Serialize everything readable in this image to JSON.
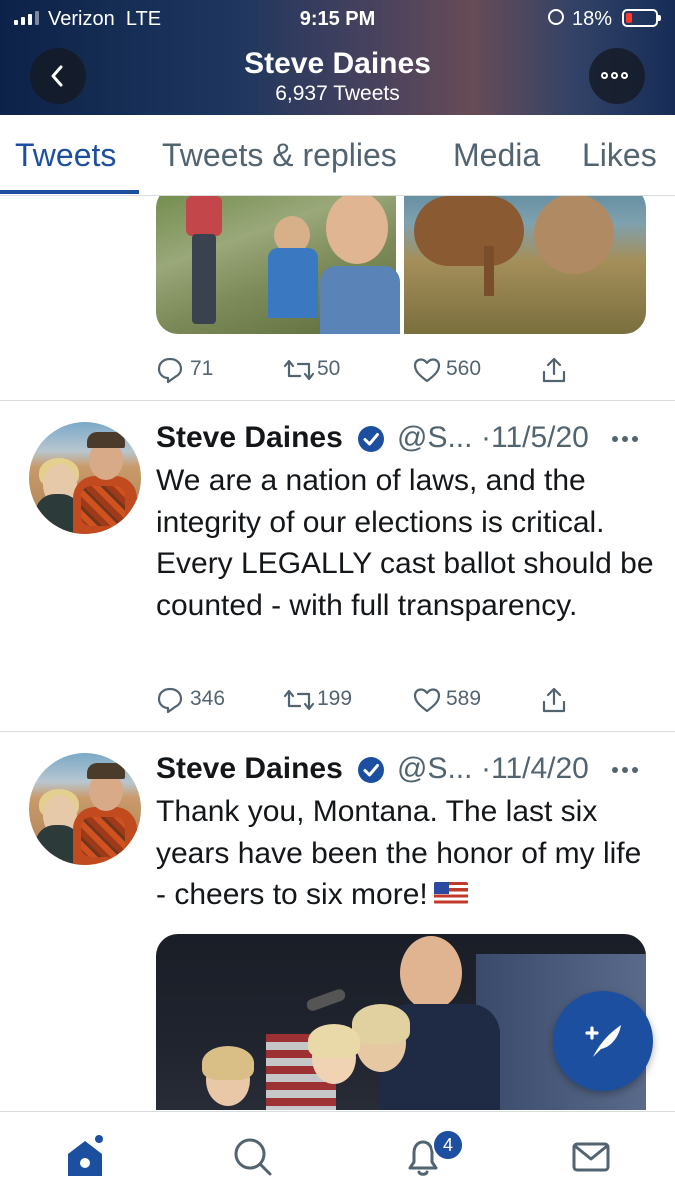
{
  "status_bar": {
    "carrier": "Verizon",
    "network": "LTE",
    "time": "9:15 PM",
    "battery": "18%"
  },
  "header": {
    "title": "Steve Daines",
    "subtitle": "6,937 Tweets"
  },
  "tabs": [
    "Tweets",
    "Tweets & replies",
    "Media",
    "Likes"
  ],
  "tweets": [
    {
      "replies": "71",
      "retweets": "50",
      "likes": "560"
    },
    {
      "name": "Steve Daines",
      "handle": "@S...",
      "date": "·11/5/20",
      "text": "We are a nation of laws, and the integrity of our elections is critical. Every LEGALLY cast ballot should be counted - with full transparency.",
      "replies": "346",
      "retweets": "199",
      "likes": "589"
    },
    {
      "name": "Steve Daines",
      "handle": "@S...",
      "date": "·11/4/20",
      "text": "Thank you, Montana.  The last six years have been the honor of my life - cheers to six more!"
    }
  ],
  "notifications_badge": "4",
  "colors": {
    "accent": "#1d4fa0",
    "text": "#14171a",
    "muted": "#536471",
    "divider": "#d8dde2"
  },
  "icons": {
    "back": "chevron-left-icon",
    "more": "more-dots-icon",
    "reply": "reply-icon",
    "retweet": "retweet-icon",
    "like": "heart-icon",
    "share": "share-icon",
    "compose": "compose-tweet-icon",
    "home": "home-icon",
    "search": "search-icon",
    "notifications": "bell-icon",
    "messages": "mail-icon"
  }
}
